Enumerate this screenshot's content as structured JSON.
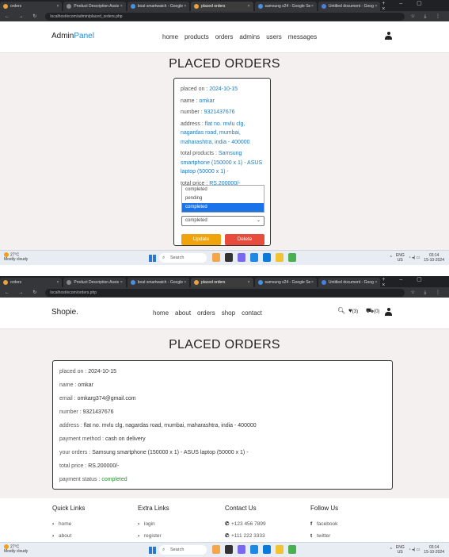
{
  "browser": {
    "tabs": [
      {
        "label": "orders"
      },
      {
        "label": "Product Description Assis"
      },
      {
        "label": "boat smartwatch - Google"
      },
      {
        "label": "placed orders"
      },
      {
        "label": "samsung s24 - Google Se"
      },
      {
        "label": "Untitled document - Goog"
      }
    ],
    "url1": "localhost/ecom/admin/placed_orders.php",
    "url2": "localhost/ecom/orders.php"
  },
  "admin": {
    "logo_main": "Admin",
    "logo_accent": "Panel",
    "menu": [
      "home",
      "products",
      "orders",
      "admins",
      "users",
      "messages"
    ],
    "title": "PLACED ORDERS",
    "order": {
      "placed_on_label": "placed on : ",
      "placed_on": "2024-10-15",
      "name_label": "name : ",
      "name": "omkar",
      "number_label": "number : ",
      "number": "9321437676",
      "address_label": "address : ",
      "address": "flat no. mvlu clg, nagardas road, mumbai, maharashtra, india - 400000",
      "products_label": "total products : ",
      "products": "Samsung smartphone (150000 x 1) - ASUS laptop (50000 x 1) -",
      "price_label": "total price : ",
      "price": "RS.200000/-"
    },
    "dropdown_options": [
      "completed",
      "pending",
      "completed"
    ],
    "dropdown_highlight_index": 2,
    "select_value": "completed",
    "update_label": "Update",
    "delete_label": "Delete"
  },
  "user": {
    "logo": "Shopie.",
    "menu": [
      "home",
      "about",
      "orders",
      "shop",
      "contact"
    ],
    "wishlist_count": "(3)",
    "cart_count": "(0)",
    "title": "PLACED ORDERS",
    "order": [
      {
        "label": "placed on : ",
        "value": "2024-10-15"
      },
      {
        "label": "name : ",
        "value": "omkar"
      },
      {
        "label": "email : ",
        "value": "omkarg374@gmail.com"
      },
      {
        "label": "number : ",
        "value": "9321437676"
      },
      {
        "label": "address : ",
        "value": "flat no. mvlu clg, nagardas road, mumbai, maharashtra, india - 400000"
      },
      {
        "label": "payment method : ",
        "value": "cash on delivery"
      },
      {
        "label": "your orders : ",
        "value": "Samsung smartphone (150000 x 1) - ASUS laptop (50000 x 1) -"
      },
      {
        "label": "total price : ",
        "value": "RS.200000/-"
      },
      {
        "label": "payment status : ",
        "value": "completed"
      }
    ],
    "footer": {
      "quick_links": {
        "heading": "Quick Links",
        "items": [
          "home",
          "about"
        ]
      },
      "extra_links": {
        "heading": "Extra Links",
        "items": [
          "login",
          "register"
        ]
      },
      "contact": {
        "heading": "Contact Us",
        "items": [
          "+123 456 7899",
          "+111 222 3333"
        ]
      },
      "follow": {
        "heading": "Follow Us",
        "items": [
          "facebook",
          "twitter"
        ]
      }
    }
  },
  "taskbar": {
    "temp": "27°C",
    "weather": "Mostly cloudy",
    "search": "Search",
    "lang": "ENG",
    "region": "US",
    "time": "03:14",
    "date": "15-10-2024"
  },
  "colors": {
    "accent_blue": "#1b7ac0",
    "update_btn": "#f0a30a",
    "delete_btn": "#e74c3c",
    "status_green": "#2e8b3a"
  }
}
